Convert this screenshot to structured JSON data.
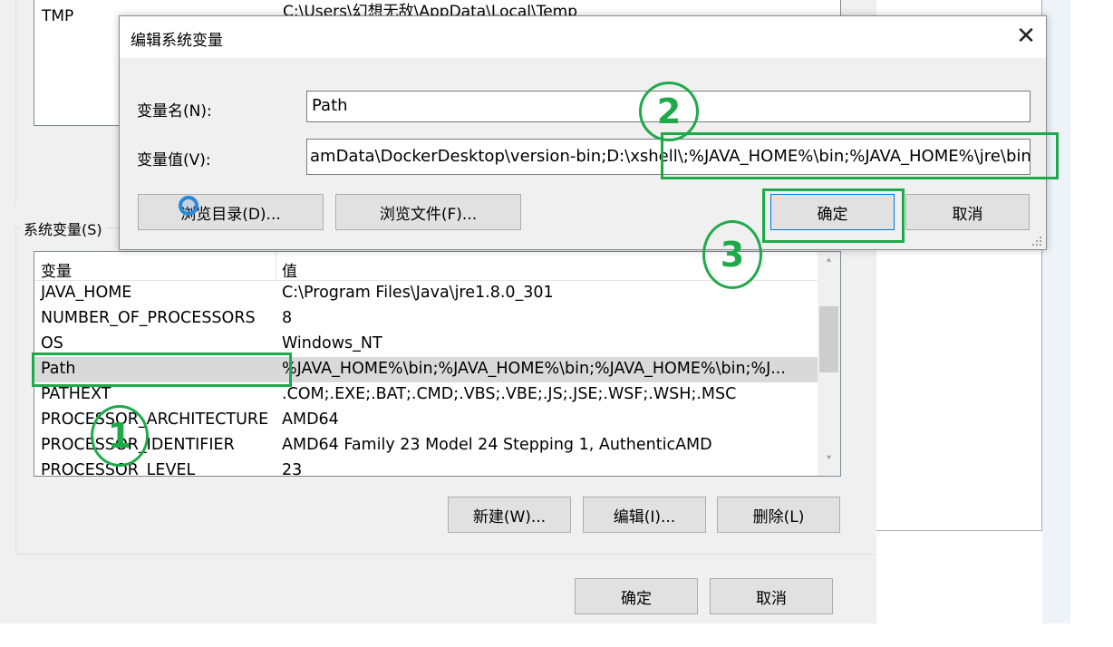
{
  "background_dialog": {
    "user_vars_partial": {
      "name": "TMP",
      "value": "C:\\Users\\幻想无敌\\AppData\\Local\\Temp"
    },
    "system_vars_label": "系统变量(S)",
    "columns": {
      "name": "变量",
      "value": "值"
    },
    "rows": [
      {
        "name": "JAVA_HOME",
        "value": "C:\\Program Files\\Java\\jre1.8.0_301"
      },
      {
        "name": "NUMBER_OF_PROCESSORS",
        "value": "8"
      },
      {
        "name": "OS",
        "value": "Windows_NT"
      },
      {
        "name": "Path",
        "value": "%JAVA_HOME%\\bin;%JAVA_HOME%\\bin;%JAVA_HOME%\\bin;%J..."
      },
      {
        "name": "PATHEXT",
        "value": ".COM;.EXE;.BAT;.CMD;.VBS;.VBE;.JS;.JSE;.WSF;.WSH;.MSC"
      },
      {
        "name": "PROCESSOR_ARCHITECTURE",
        "value": "AMD64"
      },
      {
        "name": "PROCESSOR_IDENTIFIER",
        "value": "AMD64 Family 23 Model 24 Stepping 1, AuthenticAMD"
      },
      {
        "name": "PROCESSOR_LEVEL",
        "value": "23"
      }
    ],
    "selected_row": "Path",
    "buttons": {
      "new": "新建(W)...",
      "edit": "编辑(I)...",
      "delete": "删除(L)",
      "ok": "确定",
      "cancel": "取消"
    }
  },
  "edit_dialog": {
    "title": "编辑系统变量",
    "name_label": "变量名(N):",
    "name_value": "Path",
    "value_label": "变量值(V):",
    "value_value": "amData\\DockerDesktop\\version-bin;D:\\xshell\\;%JAVA_HOME%\\bin;%JAVA_HOME%\\jre\\bin;",
    "buttons": {
      "browse_dir": "浏览目录(D)...",
      "browse_file": "浏览文件(F)...",
      "ok": "确定",
      "cancel": "取消"
    }
  },
  "annotations": {
    "step1": "1",
    "step2": "2",
    "step3": "3",
    "color": "#1faa4a"
  }
}
